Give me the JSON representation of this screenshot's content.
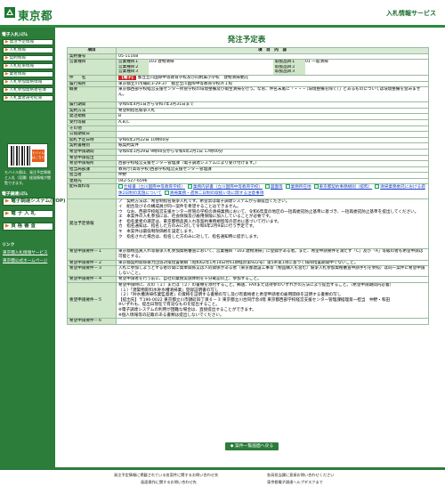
{
  "header": {
    "logo_text": "東京都",
    "system_name": "入札情報サービス"
  },
  "sidebar": {
    "section1": "電子入札ｼｽﾃﾑ",
    "items": [
      "発注予定情報",
      "入札情報",
      "契約情報",
      "入札結果情報",
      "業者情報",
      "入札参加資格情報",
      "入札参加資格者名簿",
      "入札業者選考結果"
    ],
    "section2": "電子調達ｼｽﾃﾑ",
    "btn1": "電子調達システム(TOP)",
    "btn2": "電 子 入 札",
    "btn3": "資 格 審 査",
    "mobile_badge": "モバイルはこちら",
    "mobile_text": "モバイル版は、発注予定情報と入札（見積）経過情報が閲覧できます。",
    "links_head": "リンク",
    "link1": "東京都入札情報サービス",
    "link2": "東京都公式ホームページ"
  },
  "page": {
    "title": "発注予定表",
    "col_item": "項目",
    "col_content": "項　目　内　容"
  },
  "rows": {
    "contract_no_k": "契約番号",
    "contract_no": "05-11168",
    "category_k": "営業種目",
    "cats": [
      [
        "営業種目１",
        "103 建物清掃",
        "取扱品目１",
        "01 一般清掃"
      ],
      [
        "営業種目２",
        "",
        "取扱品目２",
        ""
      ],
      [
        "営業種目３",
        "",
        "取扱品目３",
        ""
      ]
    ],
    "name_k": "件　　名",
    "name_tag": "【電子】",
    "name": "都立立川国際中等教育学校及び同附属小学校　建物清掃委託",
    "place_k": "履行場所",
    "place": "東京都立川市曙町3-29-37　都立立川国際中等教育学校外１校",
    "summary_k": "概要",
    "summary": "東京都西部学校経営支援センター所管学校の環境整備及び衛生清掃を行う。なお、件名末尾に「・・・（環境整備を除く）」とあるものについては環境整備を含みません。",
    "period_k": "履行期間",
    "period": "令和6年4月1日から令和7年3月31日まで",
    "method_k": "契約方法",
    "method": "希望制指名競争入札",
    "scale_k": "発注規模",
    "scale": "B",
    "grade_k": "受付等級",
    "grade": "A,B,C",
    "other_k": "その他",
    "other": "",
    "public_k": "公開期間日",
    "public": "",
    "bid_k": "開札予定日時",
    "bid": "令和6年2月22日 10時00分",
    "form_k": "契約書種別",
    "form": "紙契約案件",
    "apply_k": "希望申請期間",
    "apply": "令和6年1月29日 9時00分から令和6年2月1日 17時00分",
    "applyplace_k": "希望申請提出",
    "applyplace": "",
    "office_k": "希望申請場所",
    "office": "西部学校経営支援センター管理課（電子調達システムにより受け付けます。）",
    "dept_k": "担当局部課",
    "dept": "教育庁(高等学校)西部学校経営支援センター管理課",
    "person_k": "担当者",
    "person": "仲野",
    "tel_k": "連絡先",
    "tel": "042-527-6596",
    "docs_k": "配布資料等",
    "docs": [
      "仕様書（立川国際中等教育学校）",
      "業務内訳書（立川国際中等教育学校）",
      "図面等",
      "業務所在地",
      "東京都契約事務規則（抜粋）",
      "清掃業務委託における週休2日制の実施について",
      "清掃業務・週休二日制の取扱い等に関する注意事項"
    ],
    "notes_k": "発注予定情報",
    "notes": "ア　契約方法は、希望制指名競争入札です。希望票は電子調達システムから御提出ください。\nイ　組合及びその構成員が同一案件を希望することはできません。\nウ　なお、西部学校経営支援センター所管の学校の清掃業務において、令和6年度の地区の一括再委託防止基準に基づき、一括再委託防止基準を提出してください。\nエ　本案件の入札参加には、社会保険及び雇用保険に加入していることが必要です。\nオ　指名業者の選定は、東京都物品買入れ等契約事務規程等の定めに基づいて行います。\nカ　指名通知は、指名した方のみに対して令和6年2月9日に行う予定です。\nキ　本案件は最低制限価格を設定します。\nク　指名された場合は、指名した方のみに対して、指名通知時に提示します。",
    "req1_k": "希望申請要件－１",
    "req1": "東京都物品買入れ等競争入札参加資格審査において、営業種目「103 建物清掃」に登録がある者。また、希望申請要件を満たす「C」及び「A」等級の者も希望申請は可能とする。",
    "req2_k": "希望申請要件－２",
    "req2": "東京都契約関係暴力団等対策措置要綱（昭和62年1月14日付61財経庶第922号）第5条第1項に基づく排除措置期間中でないこと。",
    "req3_k": "希望申請要件－３",
    "req3": "入札に参加しようとする者の間に資本関係又は人的関係がある者（東京都建設工事等（物品購入も含む）競争入札参加資格審査申請手引を参照）は同一案件に希望申請しないこと。",
    "req4_k": "希望申請要件－４",
    "req4": "希望申請者を行う前に、自社の業務実施体制を十分確認の上、参加すること。",
    "req5_k": "希望申請要件－５",
    "req5": "希望申請時に、次の（１）または（２）の書類を添付すること。郵送、FAXまたは持参のいずれかの方法により提出すること。（希望申請期間内必着）\n（１）「建築物飲料水貯水槽清掃業」登録証明書の写し\n（２）「貯水槽清掃作業監督者」の資格を証明する書類の写し及び有資格者と希望申請者の雇用関係を証明する書類の写し\n【提出先】〒190-0022 東京都立川市錦町四丁目６－３ 東京都立川合同庁舎4階 東京都西部学校経営支援センター管理課経理第一担当　仲野・和田\n※いずれも、提出日現在で有効なものを提出すること。\n※電子調達システムの利用が困難な場合は、直接提出することができます。\n※個人情報等の記載のある書類は提出しないでください。",
    "req6_k": "希望申請要件－６",
    "req6": ""
  },
  "nav": {
    "back_button": "案件一覧画面へ戻る"
  },
  "footer": {
    "f1": "発注予定情報に掲載されている各案件に関するお問い合わせ先",
    "f2": "各局担当課に直接お問い合わせください",
    "f3": "画面操作に関するお問い合わせ先",
    "f4": "東京都電子調達ヘルプデスクまで"
  }
}
